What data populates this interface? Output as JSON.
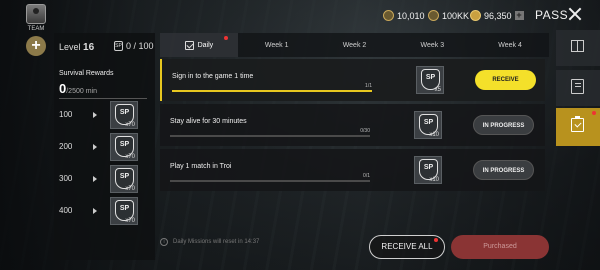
{
  "header": {
    "team_label": "TEAM",
    "currencies": [
      {
        "icon": "silver-coin-icon",
        "value": "10,010"
      },
      {
        "icon": "bp-coin-icon",
        "value": "100KK"
      },
      {
        "icon": "uc-coin-icon",
        "value": "96,350"
      }
    ],
    "pass_label": "PASS"
  },
  "left_panel": {
    "level_label": "Level",
    "level_value": "16",
    "sp_progress": "0 / 100",
    "rewards_title": "Survival Rewards",
    "rewards_current": "0",
    "rewards_total": "/2500 min",
    "rewards": [
      {
        "minutes": "100",
        "reward": "SP",
        "qty": "x70"
      },
      {
        "minutes": "200",
        "reward": "SP",
        "qty": "x70"
      },
      {
        "minutes": "300",
        "reward": "SP",
        "qty": "x70"
      },
      {
        "minutes": "400",
        "reward": "SP",
        "qty": "x70"
      }
    ]
  },
  "tabs": [
    "Daily",
    "Week 1",
    "Week 2",
    "Week 3",
    "Week 4"
  ],
  "missions": [
    {
      "title": "Sign in to the game 1 time",
      "progress": "1/1",
      "progress_fraction": 1.0,
      "reward": "SP",
      "qty": "x5",
      "button": "RECEIVE",
      "state": "receive"
    },
    {
      "title": "Stay alive for 30 minutes",
      "progress": "0/30",
      "progress_fraction": 0.0,
      "reward": "SP",
      "qty": "x10",
      "button": "IN PROGRESS",
      "state": "progress"
    },
    {
      "title": "Play 1 match in Troi",
      "progress": "0/1",
      "progress_fraction": 0.0,
      "reward": "SP",
      "qty": "x10",
      "button": "IN PROGRESS",
      "state": "progress"
    }
  ],
  "footer": {
    "reset_note": "Daily Missions will reset in 14:37",
    "receive_all": "RECEIVE ALL",
    "purchased": "Purchased"
  },
  "colors": {
    "accent": "#f4e02a",
    "rail_active": "#b8921e",
    "purchased": "#8a3434"
  }
}
